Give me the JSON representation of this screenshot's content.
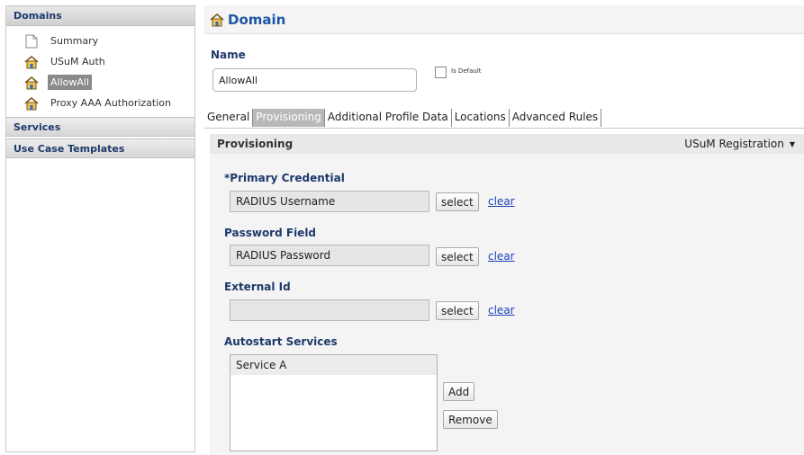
{
  "sidebar": {
    "header": "Domains",
    "items": [
      {
        "label": "Summary",
        "icon": "document-icon",
        "selected": false
      },
      {
        "label": "USuM Auth",
        "icon": "house-icon",
        "selected": false
      },
      {
        "label": "AllowAll",
        "icon": "house-icon",
        "selected": true
      },
      {
        "label": "Proxy AAA Authorization",
        "icon": "house-icon",
        "selected": false
      }
    ],
    "sections": [
      {
        "label": "Services"
      },
      {
        "label": "Use Case Templates"
      }
    ]
  },
  "main": {
    "title": "Domain",
    "title_icon": "house-icon",
    "name_label": "Name",
    "name_value": "AllowAll",
    "is_default_label": "Is Default",
    "is_default_checked": false,
    "tabs": [
      {
        "label": "General",
        "active": false
      },
      {
        "label": "Provisioning",
        "active": true
      },
      {
        "label": "Additional Profile Data",
        "active": false
      },
      {
        "label": "Locations",
        "active": false
      },
      {
        "label": "Advanced Rules",
        "active": false
      }
    ]
  },
  "provisioning": {
    "title": "Provisioning",
    "registration_select": "USuM Registration",
    "primary_credential": {
      "label": "*Primary Credential",
      "value": "RADIUS Username"
    },
    "password_field": {
      "label": "Password Field",
      "value": "RADIUS Password"
    },
    "external_id": {
      "label": "External Id",
      "value": ""
    },
    "select_label": "select",
    "clear_label": "clear",
    "autostart": {
      "label": "Autostart Services",
      "items": [
        "Service A"
      ],
      "add_label": "Add",
      "remove_label": "Remove"
    }
  },
  "colors": {
    "heading_blue": "#1d3a6b",
    "title_blue": "#1f56a6",
    "link_blue": "#1a3fb8",
    "active_tab": "#b8b8b8",
    "selected_item": "#8a8a8a"
  }
}
